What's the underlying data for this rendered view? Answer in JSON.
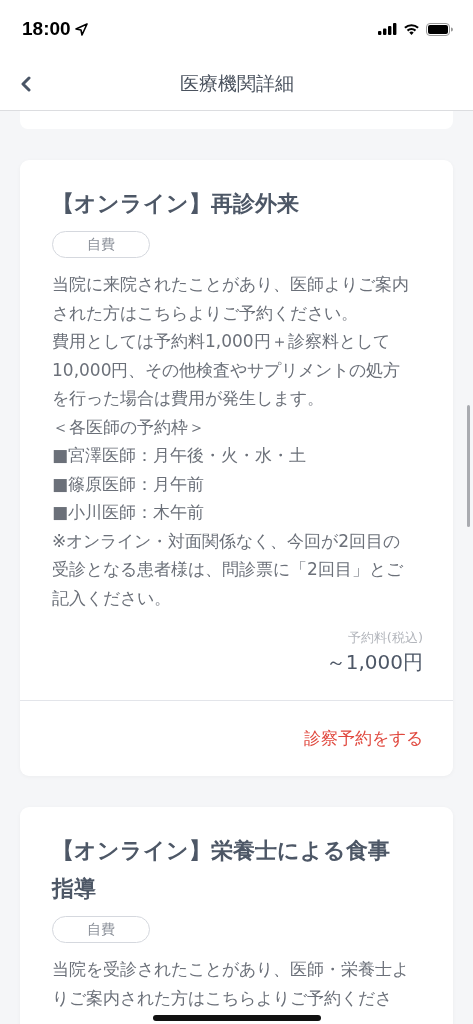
{
  "status_bar": {
    "time": "18:00"
  },
  "nav": {
    "title": "医療機関詳細"
  },
  "menus": [
    {
      "title": "【オンライン】再診外来",
      "tag": "自費",
      "description": [
        "当院に来院されたことがあり、医師よりご案内された方はこちらよりご予約ください。",
        "費用としては予約料1,000円＋診察料として10,000円、その他検査やサプリメントの処方を行った場合は費用が発生します。",
        "＜各医師の予約枠＞",
        "■宮澤医師：月午後・火・水・土",
        "■篠原医師：月午前",
        "■小川医師：木午前",
        "※オンライン・対面関係なく、今回が2回目の受診となる患者様は、問診票に「2回目」とご記入ください。"
      ],
      "price_label": "予約料(税込)",
      "price": "～1,000円",
      "action": "診察予約をする"
    },
    {
      "title": "【オンライン】栄養士による食事指導",
      "tag": "自費",
      "description": [
        "当院を受診されたことがあり、医師・栄養士よりご案内された方はこちらよりご予約くださ"
      ]
    }
  ]
}
